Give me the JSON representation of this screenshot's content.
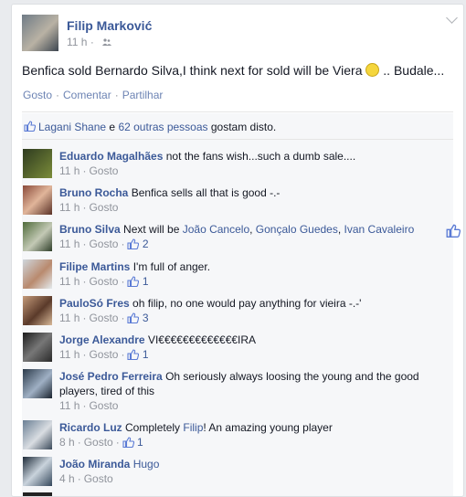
{
  "post": {
    "author": "Filip Marković",
    "time": "11 h",
    "audience_icon": "friends-icon",
    "text": "Benfica sold Bernardo Silva,I think next for sold will be Viera",
    "text_tail": ".. Budale...",
    "actions": [
      "Gosto",
      "Comentar",
      "Partilhar"
    ],
    "likes": {
      "name": "Lagani Shane",
      "conj": "e",
      "others": "62 outras pessoas",
      "suffix": "gostam disto."
    }
  },
  "comments": [
    {
      "name": "Eduardo Magalhães",
      "text": "not the fans wish...such a dumb sale....",
      "time": "11 h",
      "like_label": "Gosto",
      "likes": ""
    },
    {
      "name": "Bruno Rocha",
      "text": "Benfica sells all that is good -.-",
      "time": "11 h",
      "like_label": "Gosto",
      "likes": ""
    },
    {
      "name": "Bruno Silva",
      "text_pre": "Next will be",
      "mentions": [
        "João Cancelo",
        "Gonçalo Guedes",
        "Ivan Cavaleiro"
      ],
      "time": "11 h",
      "like_label": "Gosto",
      "likes": "2"
    },
    {
      "name": "Filipe Martins",
      "text": "I'm full of anger.",
      "time": "11 h",
      "like_label": "Gosto",
      "likes": "1"
    },
    {
      "name": "PauloSó Fres",
      "text": "oh filip, no one would pay anything for vieira -.-'",
      "time": "11 h",
      "like_label": "Gosto",
      "likes": "3"
    },
    {
      "name": "Jorge Alexandre",
      "text": "VI€€€€€€€€€€€€€IRA",
      "time": "11 h",
      "like_label": "Gosto",
      "likes": "1"
    },
    {
      "name": "José Pedro Ferreira",
      "text": "Oh seriously always loosing the young and the good players, tired of this",
      "time": "11 h",
      "like_label": "Gosto",
      "likes": ""
    },
    {
      "name": "Ricardo Luz",
      "text_pre": "Completely",
      "mention": "Filip",
      "text_post": "! An amazing young player",
      "time": "8 h",
      "like_label": "Gosto",
      "likes": "1"
    },
    {
      "name": "João Miranda",
      "mention": "Hugo",
      "time": "4 h",
      "like_label": "Gosto",
      "likes": ""
    }
  ],
  "colors": {
    "link": "#3b5998",
    "meta": "#90949c",
    "action": "#6d84b4"
  }
}
